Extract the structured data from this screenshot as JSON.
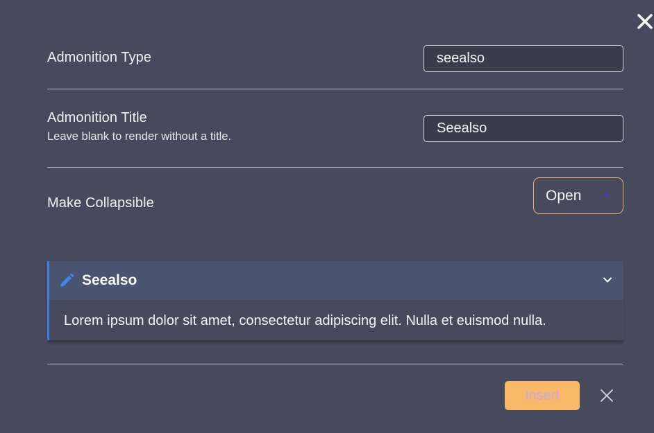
{
  "rows": {
    "type": {
      "name": "Admonition Type",
      "value": "seealso"
    },
    "title": {
      "name": "Admonition Title",
      "desc": "Leave blank to render without a title.",
      "value": "Seealso"
    },
    "collapsible": {
      "name": "Make Collapsible",
      "selected": "Open"
    }
  },
  "preview": {
    "icon": "pencil-icon",
    "title": "Seealso",
    "body": "Lorem ipsum dolor sit amet, consectetur adipiscing elit. Nulla et euismod nulla.",
    "fold_icon": "chevron-down-icon"
  },
  "footer": {
    "insert_label": "Insert",
    "cancel_icon": "close-icon"
  },
  "colors": {
    "background": "#474a5c",
    "accent": "#f9b867",
    "callout_accent": "#3f7fe0"
  }
}
